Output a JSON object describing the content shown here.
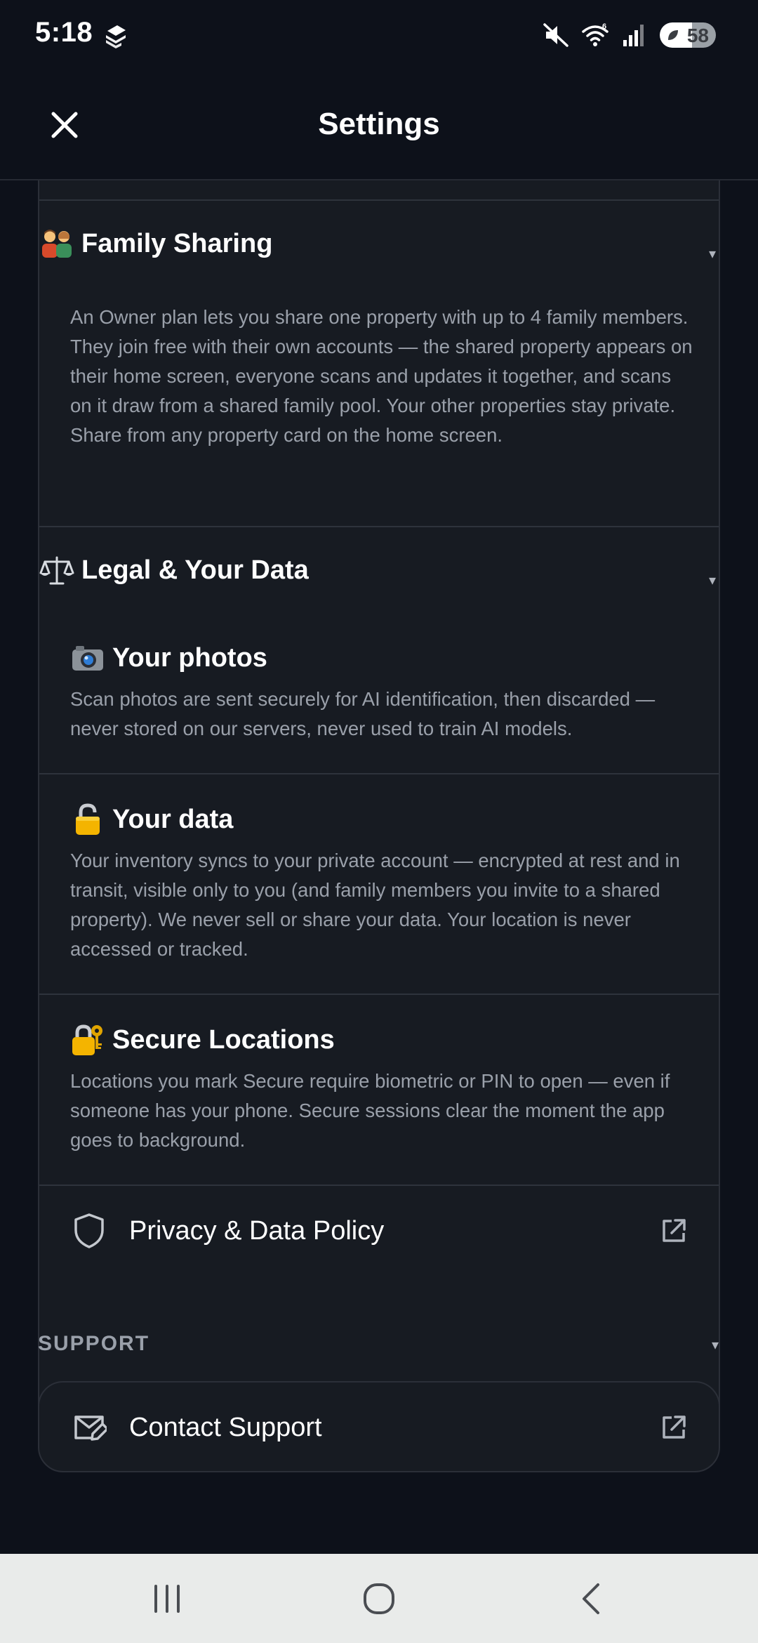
{
  "status_bar": {
    "time": "5:18",
    "wifi_badge": "6",
    "battery_percent": 58,
    "battery_label": "58",
    "icons": [
      "app-logo-icon",
      "mute-icon",
      "wifi-icon",
      "signal-icon",
      "battery-icon"
    ]
  },
  "header": {
    "title": "Settings",
    "close_icon": "close-icon"
  },
  "sections": {
    "family_sharing": {
      "emoji": "family-emoji-icon",
      "title": "Family Sharing",
      "caret": "▾",
      "body": "An Owner plan lets you share one property with up to 4 family members. They join free with their own accounts — the shared property appears on their home screen, everyone scans and updates it together, and scans on it draw from a shared family pool. Your other properties stay private. Share from any property card on the home screen."
    },
    "legal": {
      "emoji": "balance-scale-icon",
      "title": "Legal & Your Data",
      "caret": "▾",
      "items": [
        {
          "emoji": "camera-icon",
          "title": "Your photos",
          "body": "Scan photos are sent securely for AI identification, then discarded — never stored on our servers, never used to train AI models."
        },
        {
          "emoji": "padlock-icon",
          "title": "Your data",
          "body": "Your inventory syncs to your private account — encrypted at rest and in transit, visible only to you (and family members you invite to a shared property). We never sell or share your data. Your location is never accessed or tracked."
        },
        {
          "emoji": "lock-with-key-icon",
          "title": "Secure Locations",
          "body": "Locations you mark Secure require biometric or PIN to open — even if someone has your phone. Secure sessions clear the moment the app goes to background."
        }
      ],
      "privacy_link": {
        "icon": "shield-icon",
        "label": "Privacy & Data Policy",
        "trailing_icon": "external-link-icon"
      }
    },
    "support": {
      "label": "SUPPORT",
      "caret": "▾",
      "contact": {
        "icon": "mail-edit-icon",
        "label": "Contact Support",
        "trailing_icon": "external-link-icon"
      }
    }
  },
  "nav_bar": {
    "buttons": [
      "recent-apps-icon",
      "home-icon",
      "back-icon"
    ]
  },
  "colors": {
    "background": "#0d111a",
    "card": "#171b22",
    "border": "#2b2f38",
    "muted_text": "#9aa0aa",
    "nav_bar": "#e9ebea"
  }
}
